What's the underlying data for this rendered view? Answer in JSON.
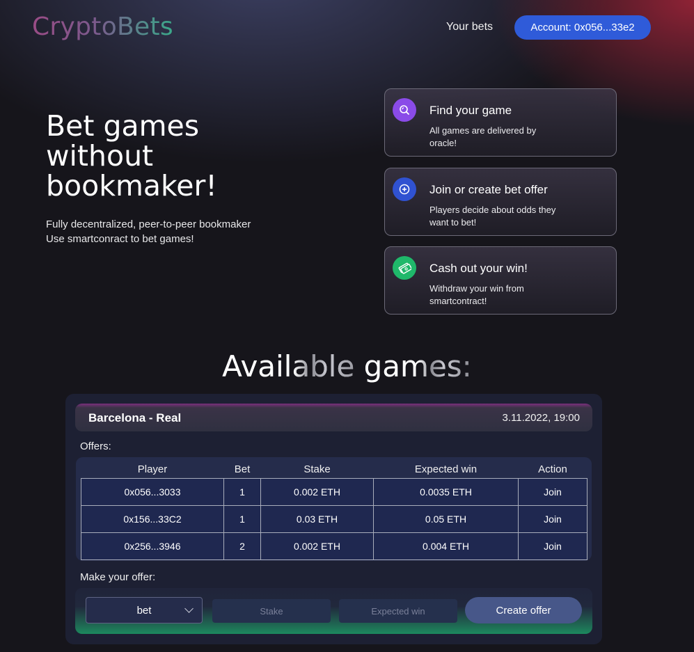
{
  "header": {
    "logo": "CryptoBets",
    "nav_your_bets": "Your bets",
    "account_label": "Account: 0x056...33e2"
  },
  "hero": {
    "title_line1": "Bet games",
    "title_line2": "without",
    "title_line3": "bookmaker!",
    "subtitle_line1": "Fully decentralized, peer-to-peer bookmaker",
    "subtitle_line2": "Use smartconract to bet games!"
  },
  "features": [
    {
      "title": "Find your game",
      "desc": "All games are delivered by oracle!",
      "icon": "search-icon",
      "color": "#8a4be8"
    },
    {
      "title": "Join or create bet offer",
      "desc": "Players decide about odds they want to bet!",
      "icon": "plus-circle-icon",
      "color": "#3052d1"
    },
    {
      "title": "Cash out your win!",
      "desc": "Withdraw your win from smartcontract!",
      "icon": "money-icon",
      "color": "#1fb86a"
    }
  ],
  "section_title_a": "Available ",
  "section_title_b": "games:",
  "game": {
    "name": "Barcelona - Real",
    "date": "3.11.2022, 19:00",
    "offers_label": "Offers:",
    "columns": [
      "Player",
      "Bet",
      "Stake",
      "Expected win",
      "Action"
    ],
    "rows": [
      {
        "player": "0x056...3033",
        "bet": "1",
        "stake": "0.002 ETH",
        "expected_win": "0.0035 ETH",
        "action": "Join"
      },
      {
        "player": "0x156...33C2",
        "bet": "1",
        "stake": "0.03 ETH",
        "expected_win": "0.05 ETH",
        "action": "Join"
      },
      {
        "player": "0x256...3946",
        "bet": "2",
        "stake": "0.002 ETH",
        "expected_win": "0.004 ETH",
        "action": "Join"
      }
    ],
    "make_offer_label": "Make your offer:",
    "bet_select_value": "bet",
    "stake_placeholder": "Stake",
    "expected_win_placeholder": "Expected win",
    "create_button": "Create offer"
  },
  "colors": {
    "account_button": "#2f5bd9",
    "card_bg": "#1d2033",
    "create_button": "#475789"
  }
}
